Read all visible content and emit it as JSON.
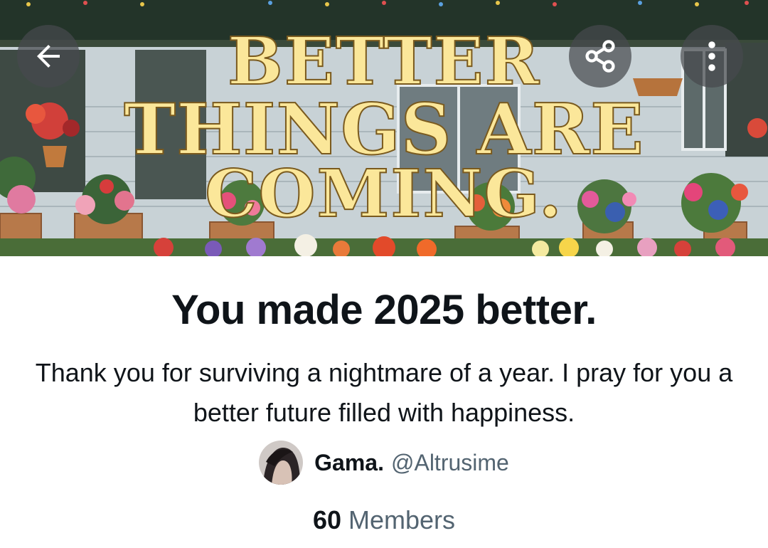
{
  "banner": {
    "image_text": "BETTER THINGS ARE COMING.",
    "back_icon": "arrow-left-icon",
    "share_icon": "share-icon",
    "more_icon": "more-vertical-icon"
  },
  "community": {
    "title": "You made 2025 better.",
    "description": "Thank you for surviving a nightmare of a year. I pray for you a better future filled with happiness.",
    "creator_name": "Gama.",
    "creator_handle": "@Altrusime",
    "member_count": "60",
    "member_label": "Members"
  },
  "colors": {
    "text_primary": "#0f1419",
    "text_secondary": "#536471",
    "banner_lettering": "#fbe79a",
    "overlay_button": "#464a4e"
  }
}
